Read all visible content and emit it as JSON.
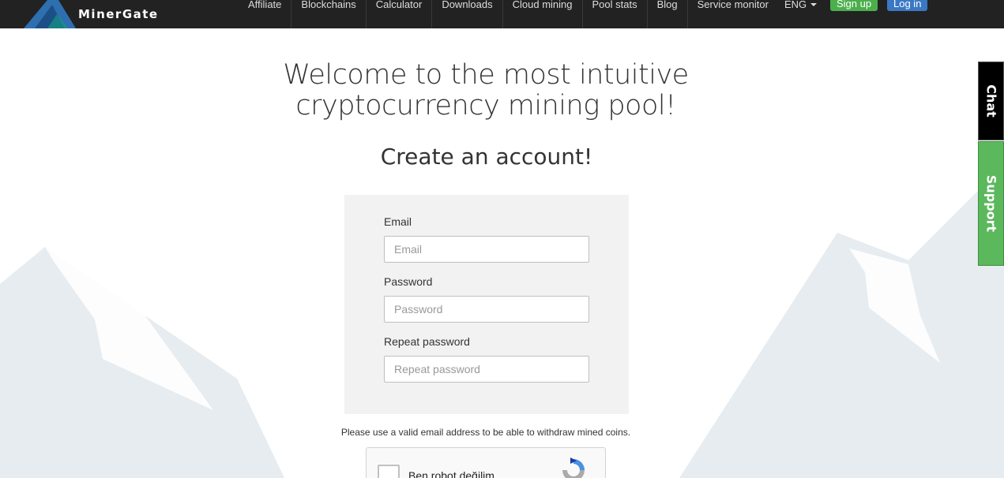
{
  "brand": {
    "name": "MinerGate"
  },
  "nav": {
    "items": [
      {
        "label": "Affiliate"
      },
      {
        "label": "Blockchains"
      },
      {
        "label": "Calculator"
      },
      {
        "label": "Downloads"
      },
      {
        "label": "Cloud mining"
      },
      {
        "label": "Pool stats"
      },
      {
        "label": "Blog"
      },
      {
        "label": "Service monitor"
      }
    ],
    "language": "ENG",
    "signup_label": "Sign up",
    "login_label": "Log in"
  },
  "main": {
    "headline": "Welcome to the most intuitive cryptocurrency mining pool!",
    "subhead": "Create an account!",
    "form": {
      "email_label": "Email",
      "email_placeholder": "Email",
      "email_value": "",
      "password_label": "Password",
      "password_placeholder": "Password",
      "password_value": "",
      "repeat_label": "Repeat password",
      "repeat_placeholder": "Repeat password",
      "repeat_value": ""
    },
    "notice": "Please use a valid email address to be able to withdraw mined coins.",
    "captcha": {
      "label": "Ben robot değilim"
    }
  },
  "side_tabs": {
    "chat": "Chat",
    "support": "Support"
  },
  "colors": {
    "header_bg": "#222222",
    "signup": "#4cae4c",
    "login": "#3a78c4",
    "support": "#5cb85c",
    "mountain": "#e6ecef"
  },
  "icons": {
    "logo": "mountain-logo-icon",
    "language_caret": "caret-down-icon",
    "captcha": "recaptcha-icon"
  }
}
